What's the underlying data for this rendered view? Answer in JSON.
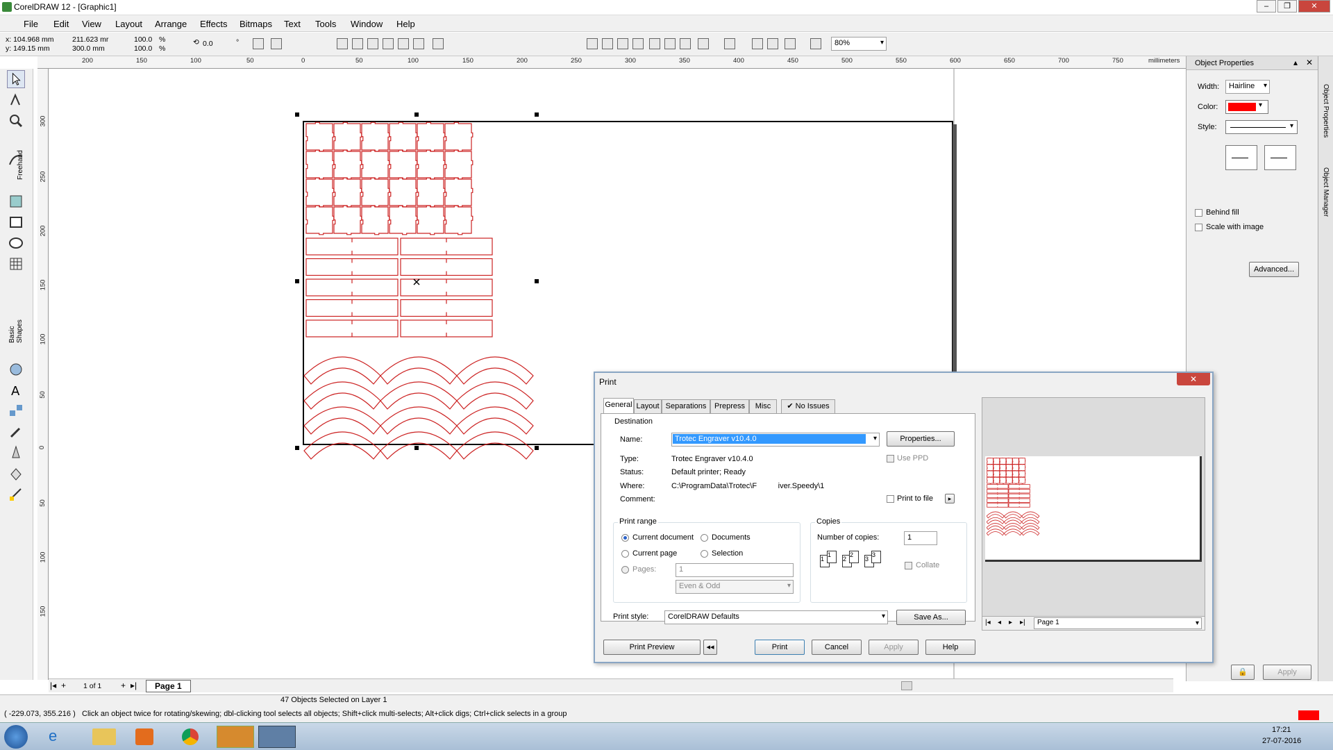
{
  "window": {
    "title": "CorelDRAW 12 - [Graphic1]"
  },
  "menu": [
    "File",
    "Edit",
    "View",
    "Layout",
    "Arrange",
    "Effects",
    "Bitmaps",
    "Text",
    "Tools",
    "Window",
    "Help"
  ],
  "propbar": {
    "x": "x: 104.968 mm",
    "y": "y: 149.15 mm",
    "w": "211.623 mr",
    "h": "300.0 mm",
    "sx": "100.0",
    "sy": "100.0",
    "pct1": "%",
    "pct2": "%",
    "angle": "0.0",
    "deg": "°",
    "zoom": "80%"
  },
  "ruler": {
    "units": "millimeters",
    "h_ticks": [
      "200",
      "150",
      "100",
      "50",
      "0",
      "50",
      "100",
      "150",
      "200",
      "250",
      "300",
      "350",
      "400",
      "450",
      "500",
      "550",
      "600",
      "650",
      "700",
      "750"
    ],
    "v_ticks": [
      "300",
      "250",
      "200",
      "150",
      "100",
      "50",
      "0",
      "50",
      "100",
      "150"
    ]
  },
  "toolbox": {
    "freehand_label": "Freehand",
    "basic_shapes_label": "Basic Shapes"
  },
  "page_nav": {
    "counter": "1 of 1",
    "tab": "Page 1"
  },
  "status": {
    "objects": "47 Objects Selected on Layer 1",
    "coords": "( -229.073, 355.216 )",
    "hint": "Click an object twice for rotating/skewing; dbl-clicking tool selects all objects; Shift+click multi-selects; Alt+click digs; Ctrl+click selects in a group"
  },
  "docker": {
    "title": "Object Properties",
    "width_label": "Width:",
    "width_value": "Hairline",
    "color_label": "Color:",
    "color_value": "#ff0000",
    "style_label": "Style:",
    "behind_fill": "Behind fill",
    "scale_with_image": "Scale with image",
    "advanced": "Advanced...",
    "apply": "Apply",
    "side_tab1": "Object Properties",
    "side_tab2": "Object Manager"
  },
  "dialog": {
    "title": "Print",
    "tabs": [
      "General",
      "Layout",
      "Separations",
      "Prepress",
      "Misc",
      "No Issues"
    ],
    "destination_label": "Destination",
    "name_label": "Name:",
    "name_value": "Trotec Engraver v10.4.0",
    "properties": "Properties...",
    "type_label": "Type:",
    "type_value": "Trotec Engraver v10.4.0",
    "status_label": "Status:",
    "status_value": "Default printer; Ready",
    "where_label": "Where:",
    "where_value": "C:\\ProgramData\\Trotec\\F          iver.Speedy\\1",
    "comment_label": "Comment:",
    "use_ppd": "Use PPD",
    "print_to_file": "Print to file",
    "print_range_label": "Print range",
    "current_document": "Current document",
    "documents": "Documents",
    "current_page": "Current page",
    "selection": "Selection",
    "pages_label": "Pages:",
    "pages_value": "1",
    "even_odd": "Even & Odd",
    "copies_label": "Copies",
    "num_copies_label": "Number of copies:",
    "num_copies_value": "1",
    "collate": "Collate",
    "print_style_label": "Print style:",
    "print_style_value": "CorelDRAW Defaults",
    "save_as": "Save As...",
    "print_preview": "Print Preview",
    "print": "Print",
    "cancel": "Cancel",
    "apply": "Apply",
    "help": "Help",
    "preview_page": "Page 1"
  },
  "taskbar": {
    "time": "17:21",
    "date": "27-07-2016"
  },
  "colors": {
    "accent_red": "#cc2222",
    "selection_blue": "#3399ff"
  }
}
